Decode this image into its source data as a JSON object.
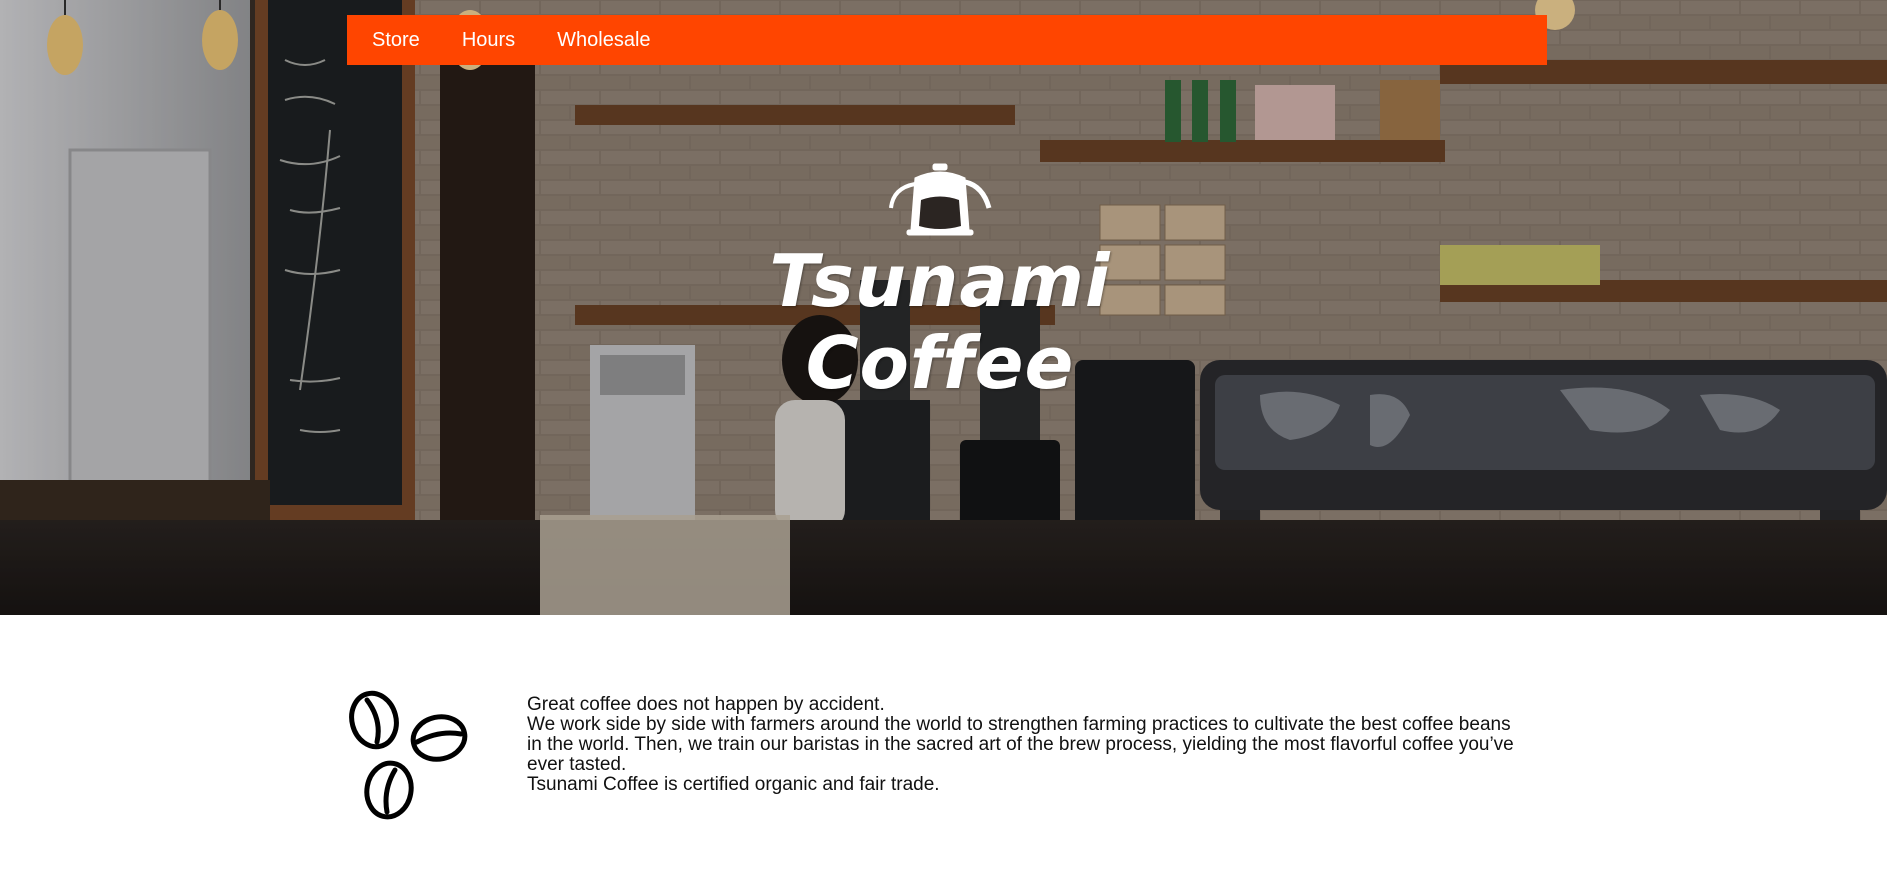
{
  "nav": {
    "items": [
      {
        "label": "Store"
      },
      {
        "label": "Hours"
      },
      {
        "label": "Wholesale"
      }
    ]
  },
  "hero": {
    "title": "Tsunami\nCoffee"
  },
  "about": {
    "line1": "Great coffee does not happen by accident.",
    "line2": "We work side by side with farmers around the world to strengthen farming practices to cultivate the best coffee beans in the world. Then, we train our baristas in the sacred art of the brew process, yielding the most flavorful coffee you’ve ever tasted.",
    "line3": "Tsunami Coffee is certified organic and fair trade."
  },
  "colors": {
    "nav_bg": "#ff4500",
    "nav_text": "#ffffff",
    "body_text": "#111111"
  },
  "icons": [
    "pour-over-kettle-icon",
    "coffee-beans-icon"
  ]
}
